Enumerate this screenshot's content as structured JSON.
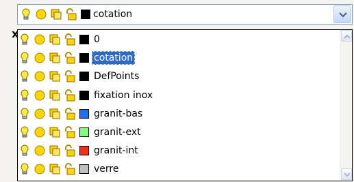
{
  "combo": {
    "selected_name": "cotation",
    "selected_color": "#000000"
  },
  "layers": [
    {
      "name": "0",
      "color": "#000000"
    },
    {
      "name": "cotation",
      "color": "#000000",
      "selected": true
    },
    {
      "name": "DefPoints",
      "color": "#000000"
    },
    {
      "name": "fixation inox",
      "color": "#000000"
    },
    {
      "name": "granit-bas",
      "color": "#1f6fff"
    },
    {
      "name": "granit-ext",
      "color": "#7dff7d"
    },
    {
      "name": "granit-int",
      "color": "#ff2b10"
    },
    {
      "name": "verre",
      "color": "#c0c0c0"
    }
  ],
  "icons": [
    "lightbulb-icon",
    "sun-icon",
    "freeze-icon",
    "lock-icon"
  ],
  "colors": {
    "selection": "#316ac5",
    "combo_border": "#7f9db9"
  },
  "cutoff_glyph": "x"
}
